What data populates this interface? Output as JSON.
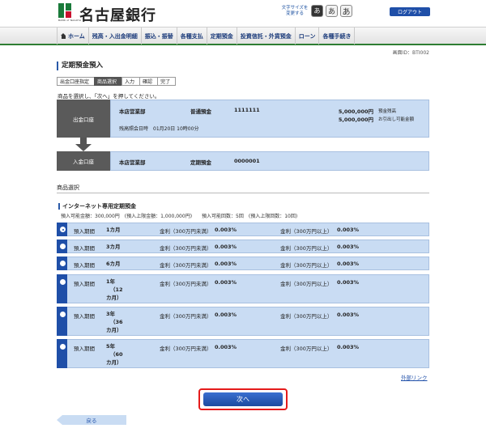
{
  "header": {
    "logo_text": "BANK of NAGOYA",
    "bank_name": "名古屋銀行",
    "font_size_label": "文字サイズを変更する",
    "font_small": "あ",
    "font_medium": "あ",
    "font_large": "あ",
    "logout": "ログアウト"
  },
  "nav": {
    "items": [
      "ホーム",
      "残高・入出金明細",
      "振込・振替",
      "各種支払",
      "定期預金",
      "投資信託・外貨預金",
      "ローン",
      "各種手続き"
    ]
  },
  "screen_id": "画面ID：BTI002",
  "page_title": "定期預金預入",
  "steps": [
    "出金口座指定",
    "商品選択",
    "入力",
    "確認",
    "完了"
  ],
  "active_step": "商品選択",
  "instruction": "商品を選択し、「次へ」を押してください。",
  "out_account": {
    "label": "出金口座",
    "branch": "本店営業部",
    "type": "普通預金",
    "number": "1111111",
    "balance": "5,000,000円",
    "balance_label": "預金残高",
    "available": "5,000,000円",
    "available_label": "お引出し可能金額",
    "datetime": "残高照会日時　01月20日 10時00分"
  },
  "in_account": {
    "label": "入金口座",
    "branch": "本店営業部",
    "type": "定期預金",
    "number": "0000001"
  },
  "section_title": "商品選択",
  "product": {
    "name": "インターネット専用定期預金",
    "info": "預入可能金額：300,000円　(預入上限金額：1,000,000円)　　預入可能回数：5回　(預入上限回数：10回)"
  },
  "options": [
    {
      "label": "預入期間",
      "term": [
        "1カ月"
      ],
      "rate1_label": "金利（300万円未満）",
      "rate1": "0.003%",
      "rate2_label": "金利（300万円以上）",
      "rate2": "0.003%",
      "checked": true
    },
    {
      "label": "預入期間",
      "term": [
        "3カ月"
      ],
      "rate1_label": "金利（300万円未満）",
      "rate1": "0.003%",
      "rate2_label": "金利（300万円以上）",
      "rate2": "0.003%",
      "checked": false
    },
    {
      "label": "預入期間",
      "term": [
        "6カ月"
      ],
      "rate1_label": "金利（300万円未満）",
      "rate1": "0.003%",
      "rate2_label": "金利（300万円以上）",
      "rate2": "0.003%",
      "checked": false
    },
    {
      "label": "預入期間",
      "term": [
        "1年",
        "（12",
        "カ月）"
      ],
      "rate1_label": "金利（300万円未満）",
      "rate1": "0.003%",
      "rate2_label": "金利（300万円以上）",
      "rate2": "0.003%",
      "checked": false
    },
    {
      "label": "預入期間",
      "term": [
        "3年",
        "（36",
        "カ月）"
      ],
      "rate1_label": "金利（300万円未満）",
      "rate1": "0.003%",
      "rate2_label": "金利（300万円以上）",
      "rate2": "0.003%",
      "checked": false
    },
    {
      "label": "預入期間",
      "term": [
        "5年",
        "（60",
        "カ月）"
      ],
      "rate1_label": "金利（300万円未満）",
      "rate1": "0.003%",
      "rate2_label": "金利（300万円以上）",
      "rate2": "0.003%",
      "checked": false
    }
  ],
  "external_link": "外部リンク",
  "next_button": "次へ",
  "back_button": "戻る",
  "colors": {
    "accent": "#1f4fa8",
    "row_bg": "#c9dcf3",
    "label_bg": "#5a5a5a",
    "nav_border": "#2e7d32",
    "highlight": "#e51b1b"
  }
}
